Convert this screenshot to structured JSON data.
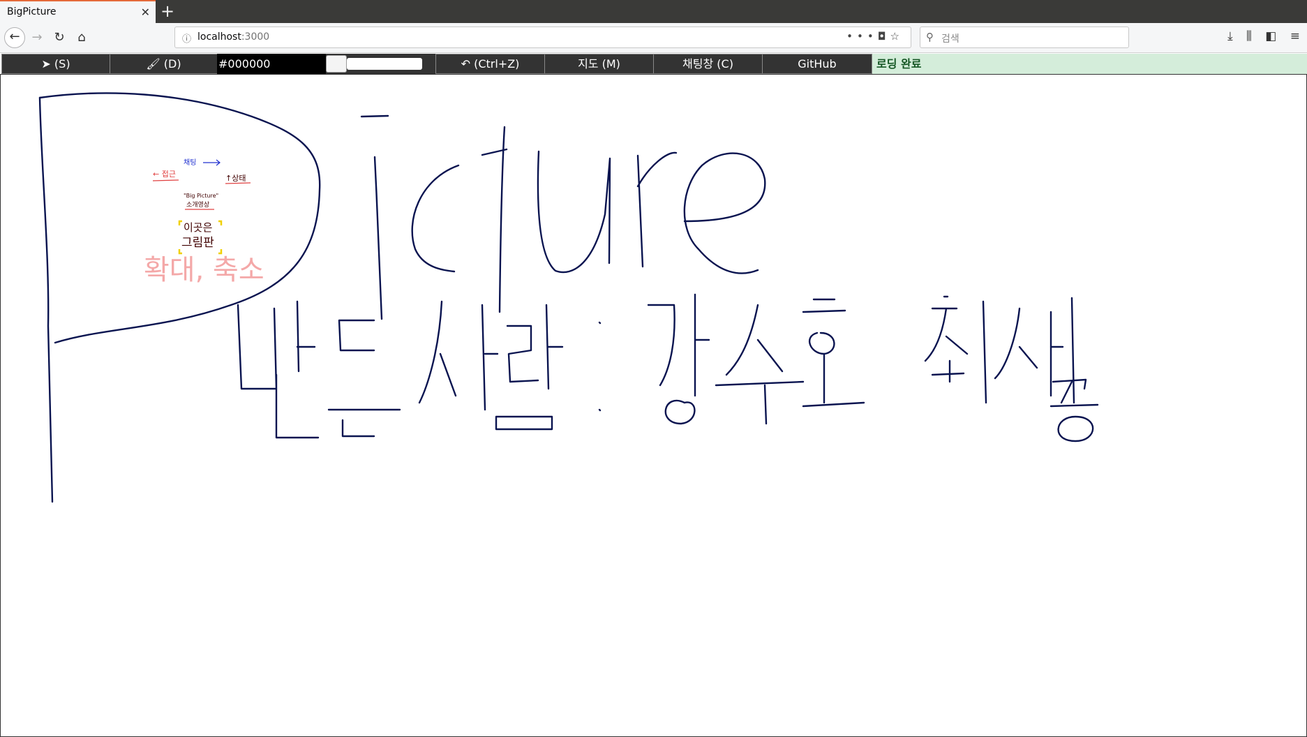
{
  "browser": {
    "tab_title": "BigPicture",
    "tab_close": "✕",
    "new_tab": "+",
    "url_host": "localhost",
    "url_port": ":3000",
    "search_placeholder": "검색"
  },
  "toolbar": {
    "select_label": "(S)",
    "draw_label": "(D)",
    "color_value": "#000000",
    "undo_label": "(Ctrl+Z)",
    "map_label": "지도 (M)",
    "chat_label": "채팅창 (C)",
    "github_label": "GitHub",
    "status_text": "로딩 완료",
    "status_color": "#155724",
    "brush_size_fraction": 0.0
  },
  "canvas": {
    "stroke_color": "#0a1450",
    "annotations": {
      "chat": "채팅",
      "left": "← 접근",
      "right": "↑상태",
      "intro_line1": "\"Big Picture\"",
      "intro_line2": "소개영상",
      "board_line1": "이곳은",
      "board_line2": "그림판",
      "zoom": "확대, 축소"
    },
    "handwriting": {
      "word": "Picture",
      "credits": "만든사람 : 강수호 최세종"
    }
  },
  "icons": {
    "back": "back-arrow-icon",
    "forward": "forward-arrow-icon",
    "reload": "reload-icon",
    "home": "home-icon",
    "select_tool": "cursor-icon",
    "draw_tool": "paintbrush-icon",
    "undo": "undo-icon"
  }
}
